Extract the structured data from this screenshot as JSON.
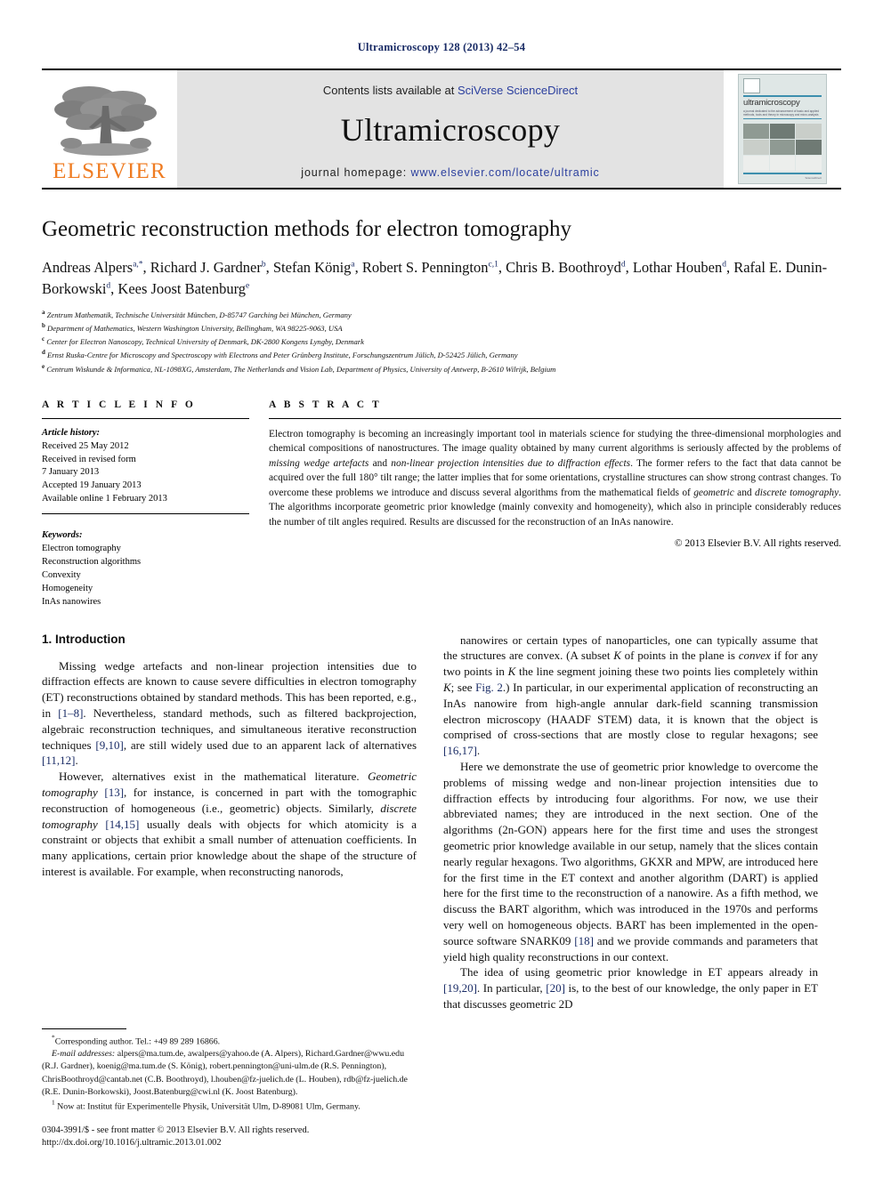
{
  "running_head": "Ultramicroscopy 128 (2013) 42–54",
  "masthead": {
    "publisher_name": "ELSEVIER",
    "contents_prefix": "Contents lists available at ",
    "contents_link": "SciVerse ScienceDirect",
    "journal_name": "Ultramicroscopy",
    "homepage_prefix": "journal homepage: ",
    "homepage_link": "www.elsevier.com/locate/ultramic",
    "cover": {
      "title": "ultramicroscopy",
      "subtitle": "a journal dedicated to the advancement of basic and applied methods, tools and theory in microscopy and micro-analysis",
      "footer": "ScienceDirect"
    }
  },
  "article": {
    "title": "Geometric reconstruction methods for electron tomography",
    "authors": [
      {
        "name": "Andreas Alpers",
        "marks": "a,*"
      },
      {
        "name": "Richard J. Gardner",
        "marks": "b"
      },
      {
        "name": "Stefan König",
        "marks": "a"
      },
      {
        "name": "Robert S. Pennington",
        "marks": "c,1"
      },
      {
        "name": "Chris B. Boothroyd",
        "marks": "d"
      },
      {
        "name": "Lothar Houben",
        "marks": "d"
      },
      {
        "name": "Rafal E. Dunin-Borkowski",
        "marks": "d"
      },
      {
        "name": "Kees Joost Batenburg",
        "marks": "e"
      }
    ],
    "affiliations": [
      {
        "mark": "a",
        "text": "Zentrum Mathematik, Technische Universität München, D-85747 Garching bei München, Germany"
      },
      {
        "mark": "b",
        "text": "Department of Mathematics, Western Washington University, Bellingham, WA 98225-9063, USA"
      },
      {
        "mark": "c",
        "text": "Center for Electron Nanoscopy, Technical University of Denmark, DK-2800 Kongens Lyngby, Denmark"
      },
      {
        "mark": "d",
        "text": "Ernst Ruska-Centre for Microscopy and Spectroscopy with Electrons and Peter Grünberg Institute, Forschungszentrum Jülich, D-52425 Jülich, Germany"
      },
      {
        "mark": "e",
        "text": "Centrum Wiskunde & Informatica, NL-1098XG, Amsterdam, The Netherlands and Vision Lab, Department of Physics, University of Antwerp, B-2610 Wilrijk, Belgium"
      }
    ]
  },
  "article_info": {
    "heading": "A R T I C L E   I N F O",
    "history_label": "Article history:",
    "history": [
      "Received 25 May 2012",
      "Received in revised form",
      "7 January 2013",
      "Accepted 19 January 2013",
      "Available online 1 February 2013"
    ],
    "keywords_label": "Keywords:",
    "keywords": [
      "Electron tomography",
      "Reconstruction algorithms",
      "Convexity",
      "Homogeneity",
      "InAs nanowires"
    ]
  },
  "abstract": {
    "heading": "A B S T R A C T",
    "paragraph_parts": [
      {
        "t": "Electron tomography is becoming an increasingly important tool in materials science for studying the three-dimensional morphologies and chemical compositions of nanostructures. The image quality obtained by many current algorithms is seriously affected by the problems of ",
        "i": false
      },
      {
        "t": "missing wedge artefacts",
        "i": true
      },
      {
        "t": " and ",
        "i": false
      },
      {
        "t": "non-linear projection intensities due to diffraction effects",
        "i": true
      },
      {
        "t": ". The former refers to the fact that data cannot be acquired over the full 180° tilt range; the latter implies that for some orientations, crystalline structures can show strong contrast changes. To overcome these problems we introduce and discuss several algorithms from the mathematical fields of ",
        "i": false
      },
      {
        "t": "geometric",
        "i": true
      },
      {
        "t": " and ",
        "i": false
      },
      {
        "t": "discrete tomography",
        "i": true
      },
      {
        "t": ". The algorithms incorporate geometric prior knowledge (mainly convexity and homogeneity), which also in principle considerably reduces the number of tilt angles required. Results are discussed for the reconstruction of an InAs nanowire.",
        "i": false
      }
    ],
    "copyright": "© 2013 Elsevier B.V. All rights reserved."
  },
  "body": {
    "section_number_title": "1.  Introduction",
    "left_paragraphs": [
      [
        {
          "t": "Missing wedge artefacts and non-linear projection intensities due to diffraction effects are known to cause severe difficulties in electron tomography (ET) reconstructions obtained by standard methods. This has been reported, e.g., in ",
          "k": "p"
        },
        {
          "t": "[1–8]",
          "k": "r"
        },
        {
          "t": ". Nevertheless, standard methods, such as filtered backprojection, algebraic reconstruction techniques, and simultaneous iterative reconstruction techniques ",
          "k": "p"
        },
        {
          "t": "[9,10]",
          "k": "r"
        },
        {
          "t": ", are still widely used due to an apparent lack of alternatives ",
          "k": "p"
        },
        {
          "t": "[11,12]",
          "k": "r"
        },
        {
          "t": ".",
          "k": "p"
        }
      ],
      [
        {
          "t": "However, alternatives exist in the mathematical literature. ",
          "k": "p"
        },
        {
          "t": "Geometric tomography",
          "k": "i"
        },
        {
          "t": " ",
          "k": "p"
        },
        {
          "t": "[13]",
          "k": "r"
        },
        {
          "t": ", for instance, is concerned in part with the tomographic reconstruction of homogeneous (i.e., geometric) objects. Similarly, ",
          "k": "p"
        },
        {
          "t": "discrete tomography",
          "k": "i"
        },
        {
          "t": " ",
          "k": "p"
        },
        {
          "t": "[14,15]",
          "k": "r"
        },
        {
          "t": " usually deals with objects for which atomicity is a constraint or objects that exhibit a small number of attenuation coefficients. In many applications, certain prior knowledge about the shape of the structure of interest is available. For example, when reconstructing nanorods,",
          "k": "p"
        }
      ]
    ],
    "right_paragraphs": [
      [
        {
          "t": "nanowires or certain types of nanoparticles, one can typically assume that the structures are convex. (A subset ",
          "k": "p"
        },
        {
          "t": "K",
          "k": "i"
        },
        {
          "t": " of points in the plane is ",
          "k": "p"
        },
        {
          "t": "convex",
          "k": "i"
        },
        {
          "t": " if for any two points in ",
          "k": "p"
        },
        {
          "t": "K",
          "k": "i"
        },
        {
          "t": " the line segment joining these two points lies completely within ",
          "k": "p"
        },
        {
          "t": "K",
          "k": "i"
        },
        {
          "t": "; see ",
          "k": "p"
        },
        {
          "t": "Fig. 2",
          "k": "r"
        },
        {
          "t": ".) In particular, in our experimental application of reconstructing an InAs nanowire from high-angle annular dark-field scanning transmission electron microscopy (HAADF STEM) data, it is known that the object is comprised of cross-sections that are mostly close to regular hexagons; see ",
          "k": "p"
        },
        {
          "t": "[16,17]",
          "k": "r"
        },
        {
          "t": ".",
          "k": "p"
        }
      ],
      [
        {
          "t": "Here we demonstrate the use of geometric prior knowledge to overcome the problems of missing wedge and non-linear projection intensities due to diffraction effects by introducing four algorithms. For now, we use their abbreviated names; they are introduced in the next section. One of the algorithms (2n-GON) appears here for the first time and uses the strongest geometric prior knowledge available in our setup, namely that the slices contain nearly regular hexagons. Two algorithms, GKXR and MPW, are introduced here for the first time in the ET context and another algorithm (DART) is applied here for the first time to the reconstruction of a nanowire. As a fifth method, we discuss the BART algorithm, which was introduced in the 1970s and performs very well on homogeneous objects. BART has been implemented in the open-source software SNARK09 ",
          "k": "p"
        },
        {
          "t": "[18]",
          "k": "r"
        },
        {
          "t": " and we provide commands and parameters that yield high quality reconstructions in our context.",
          "k": "p"
        }
      ],
      [
        {
          "t": "The idea of using geometric prior knowledge in ET appears already in ",
          "k": "p"
        },
        {
          "t": "[19,20]",
          "k": "r"
        },
        {
          "t": ". In particular, ",
          "k": "p"
        },
        {
          "t": "[20]",
          "k": "r"
        },
        {
          "t": " is, to the best of our knowledge, the only paper in ET that discusses geometric 2D",
          "k": "p"
        }
      ]
    ]
  },
  "footnotes": {
    "corresponding": "Corresponding author. Tel.: +49 89 289 16866.",
    "email_label": "E-mail addresses:",
    "emails": "alpers@ma.tum.de, awalpers@yahoo.de (A. Alpers), Richard.Gardner@wwu.edu (R.J. Gardner), koenig@ma.tum.de (S. König), robert.pennington@uni-ulm.de (R.S. Pennington), ChrisBoothroyd@cantab.net (C.B. Boothroyd), l.houben@fz-juelich.de (L. Houben), rdb@fz-juelich.de (R.E. Dunin-Borkowski), Joost.Batenburg@cwi.nl (K. Joost Batenburg).",
    "note_1_mark": "1",
    "note_1": "Now at: Institut für Experimentelle Physik, Universität Ulm, D-89081 Ulm, Germany."
  },
  "imprint": {
    "line1": "0304-3991/$ - see front matter © 2013 Elsevier B.V. All rights reserved.",
    "line2": "http://dx.doi.org/10.1016/j.ultramic.2013.01.002"
  },
  "colors": {
    "link": "#2b3f9e",
    "reference": "#1a2c66",
    "elsevier_orange": "#ef7c22",
    "masthead_gray": "#e3e3e3"
  }
}
